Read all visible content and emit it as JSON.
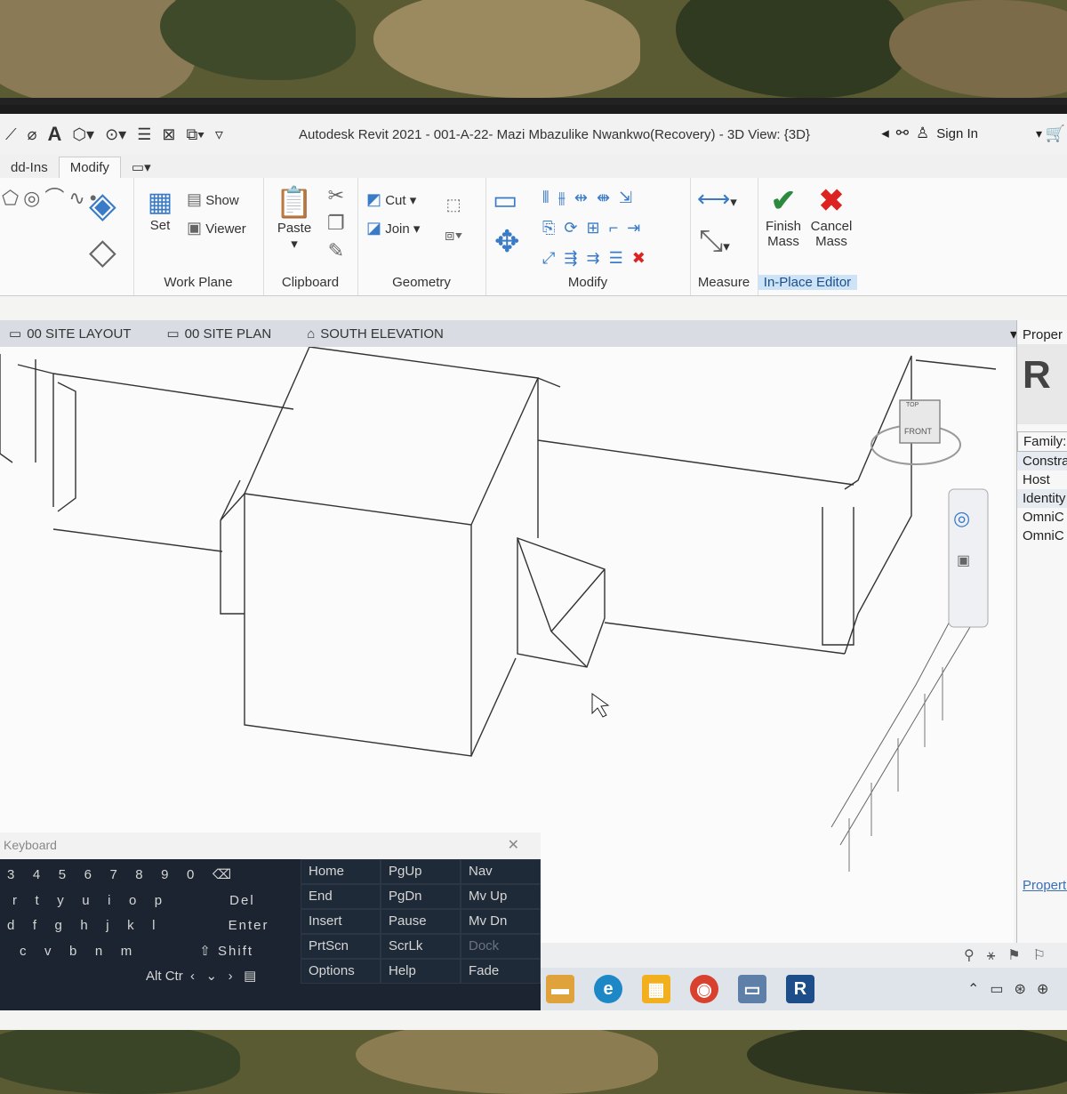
{
  "titlebar": {
    "app_title": "Autodesk Revit 2021 - 001-A-22- Mazi Mbazulike Nwankwo(Recovery) - 3D View: {3D}",
    "sign_in": "Sign In"
  },
  "tabs": [
    {
      "label": "dd-Ins"
    },
    {
      "label": "Modify"
    }
  ],
  "ribbon": {
    "work_plane": {
      "title": "Work Plane",
      "set": "Set",
      "show": "Show",
      "viewer": "Viewer"
    },
    "clipboard": {
      "title": "Clipboard",
      "paste": "Paste"
    },
    "geometry": {
      "title": "Geometry",
      "cut": "Cut",
      "join": "Join"
    },
    "modify": {
      "title": "Modify"
    },
    "measure": {
      "title": "Measure"
    },
    "in_place_editor": {
      "title": "In-Place Editor",
      "finish_mass": "Finish\nMass",
      "finish_1": "Finish",
      "finish_2": "Mass",
      "cancel_1": "Cancel",
      "cancel_2": "Mass"
    }
  },
  "view_tabs": [
    {
      "label": "00 SITE LAYOUT"
    },
    {
      "label": "00 SITE PLAN"
    },
    {
      "label": "SOUTH ELEVATION"
    }
  ],
  "viewcube": {
    "top": "TOP",
    "front": "FRONT"
  },
  "properties": {
    "title": "Proper",
    "family": "Family:",
    "constraints": "Constra",
    "host": "Host",
    "identity": "Identity",
    "omni1": "OmniC",
    "omni2": "OmniC",
    "link": "Properties"
  },
  "keyboard": {
    "title": "Keyboard",
    "row1": [
      "3",
      "4",
      "5",
      "6",
      "7",
      "8",
      "9",
      "0"
    ],
    "row2": [
      "r",
      "t",
      "y",
      "u",
      "i",
      "o",
      "p",
      "Del"
    ],
    "row3": [
      "d",
      "f",
      "g",
      "h",
      "j",
      "k",
      "l",
      "Enter"
    ],
    "row4": [
      "c",
      "v",
      "b",
      "n",
      "m",
      "Shift"
    ],
    "row5": [
      "Alt",
      "Ctr"
    ],
    "nav_keys": [
      [
        "Home",
        "PgUp",
        "Nav"
      ],
      [
        "End",
        "PgDn",
        "Mv Up"
      ],
      [
        "Insert",
        "Pause",
        "Mv Dn"
      ],
      [
        "PrtScn",
        "ScrLk",
        "Dock"
      ],
      [
        "Options",
        "Help",
        "Fade"
      ]
    ]
  },
  "taskbar": {
    "revit_icon": "R"
  }
}
